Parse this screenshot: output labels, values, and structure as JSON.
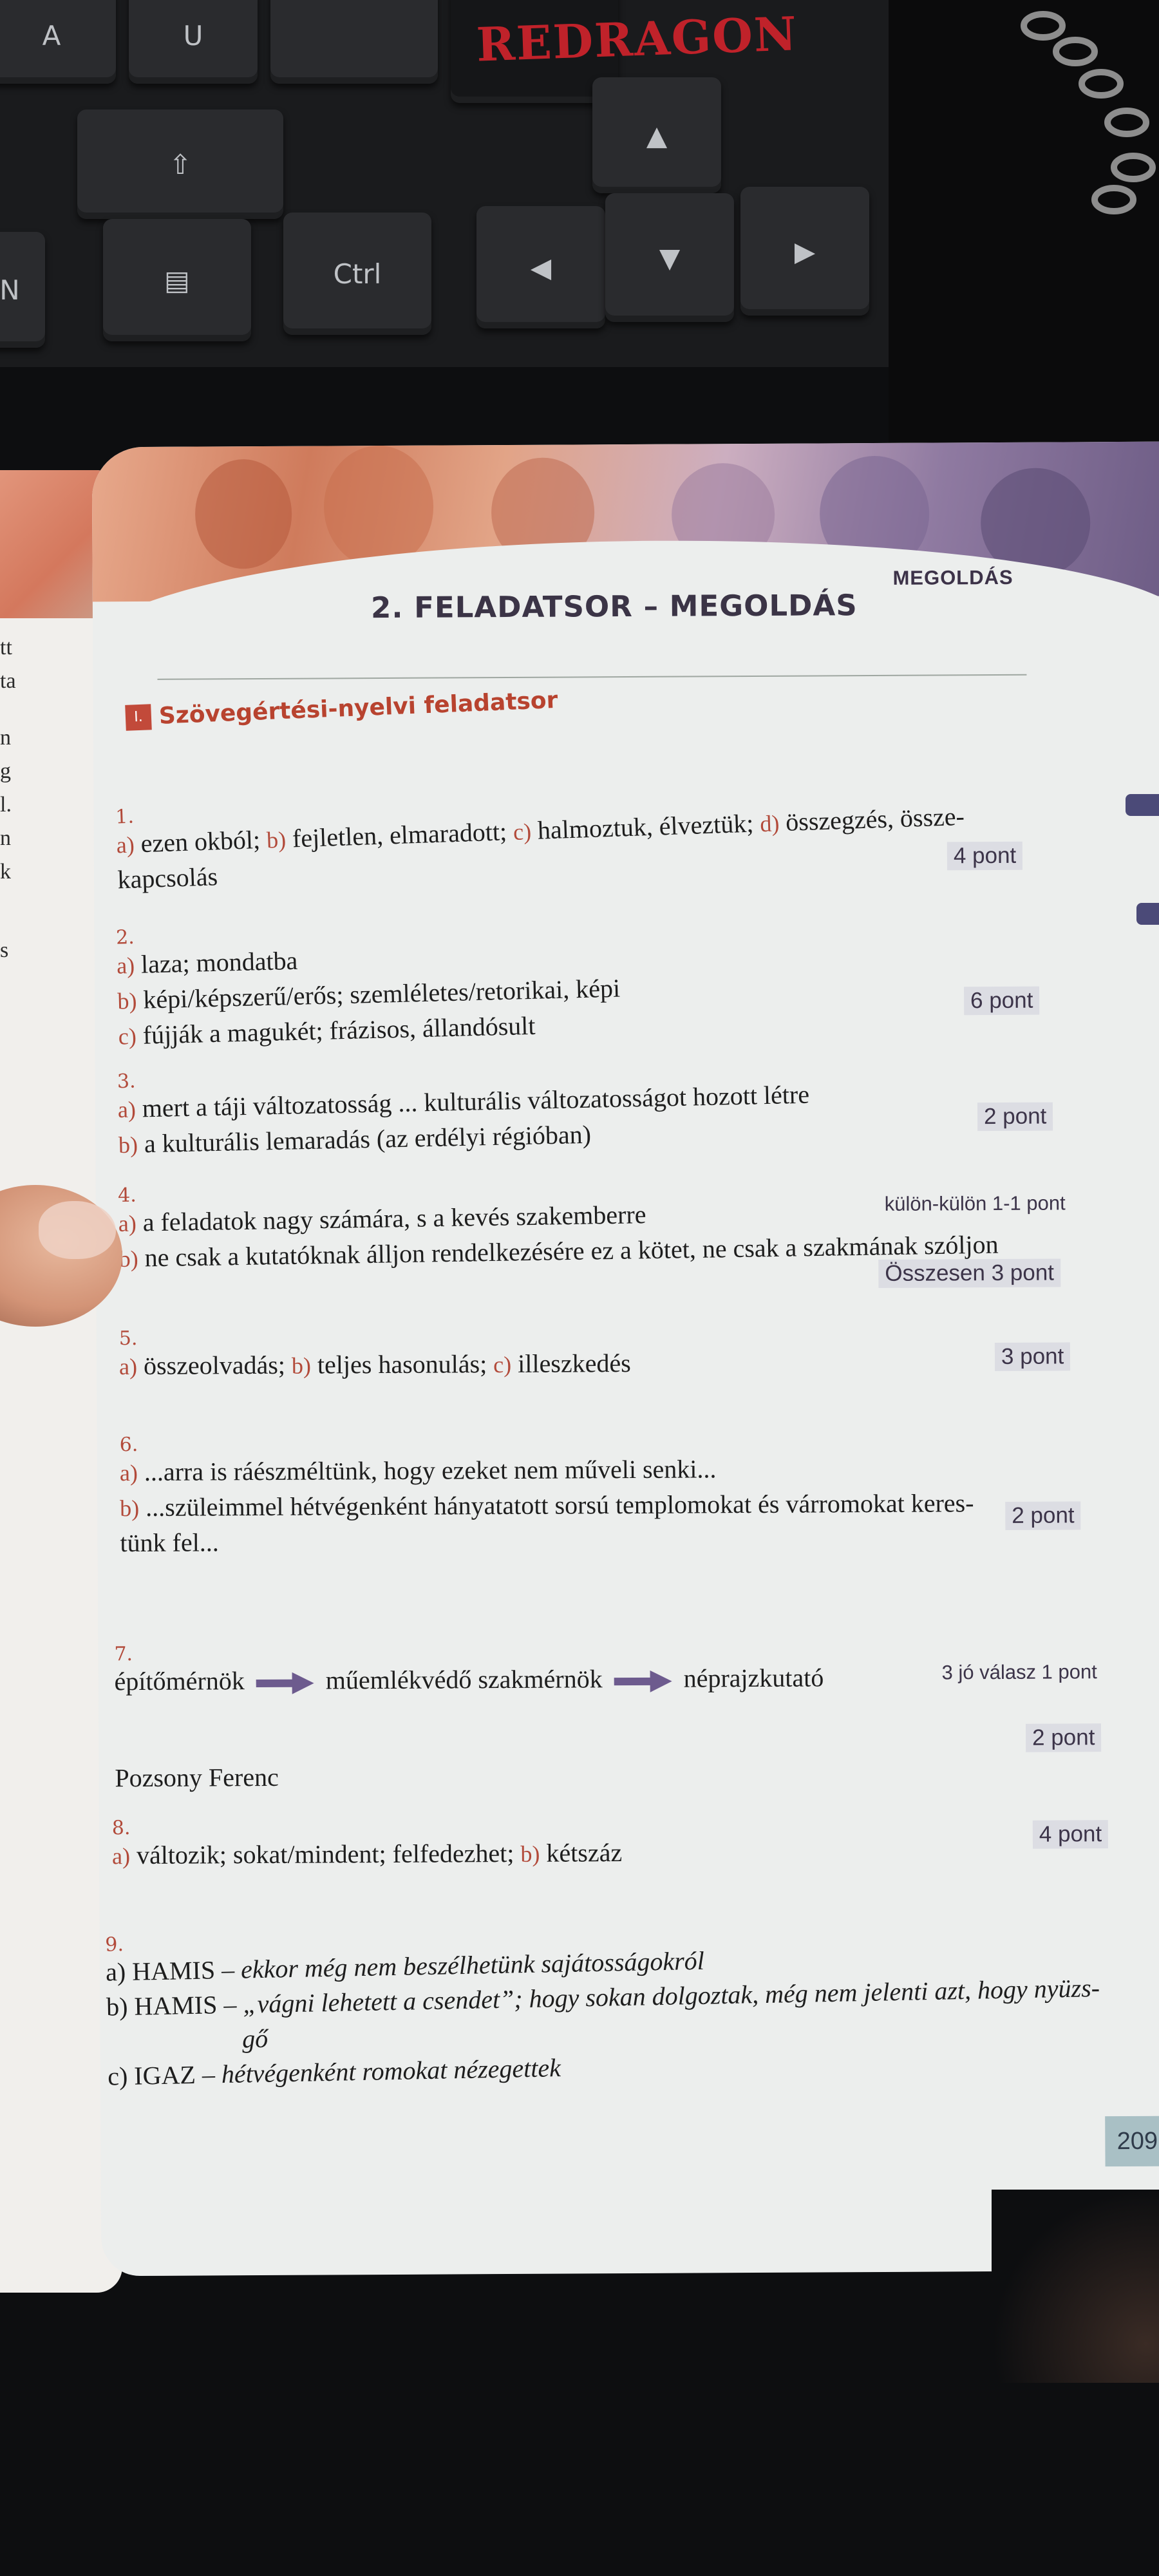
{
  "keyboard": {
    "brand": "REDRAGON",
    "keys": {
      "ctrl": "Ctrl",
      "n": "N",
      "a": "A",
      "u": "U"
    }
  },
  "left_page": {
    "letters": [
      "tt",
      "ta",
      "n",
      "g",
      "l.",
      "n",
      "k",
      "s"
    ]
  },
  "header": {
    "tag": "MEGOLDÁS",
    "title": "2. FELADATSOR – MEGOLDÁS"
  },
  "section": {
    "number": "I.",
    "title": "Szövegértési-nyelvi feladatsor"
  },
  "questions": {
    "q1": {
      "num": "1.",
      "a_label": "a)",
      "a": "ezen okból;",
      "b_label": "b)",
      "b": "fejletlen, elmaradott;",
      "c_label": "c)",
      "c": "halmoztuk, élveztük;",
      "d_label": "d)",
      "d": "összegzés, össze-",
      "cont": "kapcsolás",
      "points": "4 pont"
    },
    "q2": {
      "num": "2.",
      "a_label": "a)",
      "a": "laza; mondatba",
      "b_label": "b)",
      "b": "képi/képszerű/erős; szemléletes/retorikai, képi",
      "c_label": "c)",
      "c": "fújják a magukét; frázisos, állandósult",
      "points": "6 pont"
    },
    "q3": {
      "num": "3.",
      "a_label": "a)",
      "a": "mert a táji változatosság ... kulturális változatosságot hozott létre",
      "b_label": "b)",
      "b": "a kulturális lemaradás (az erdélyi régióban)",
      "points": "2 pont"
    },
    "q4": {
      "num": "4.",
      "a_label": "a)",
      "a": "a feladatok nagy számára, s a kevés szakemberre",
      "b_label": "b)",
      "b": "ne csak a kutatóknak álljon rendelkezésére ez a kötet, ne csak a szakmának szóljon",
      "points_each": "külön-külön 1-1 pont",
      "points_total": "Összesen 3 pont"
    },
    "q5": {
      "num": "5.",
      "a_label": "a)",
      "a": "összeolvadás;",
      "b_label": "b)",
      "b": "teljes hasonulás;",
      "c_label": "c)",
      "c": "illeszkedés",
      "points": "3 pont"
    },
    "q6": {
      "num": "6.",
      "a_label": "a)",
      "a": "...arra is ráészméltünk, hogy ezeket nem műveli senki...",
      "b_label": "b)",
      "b": "...szüleimmel hétvégenként hányatatott sorsú templomokat és várromokat keres-",
      "cont": "tünk fel...",
      "points": "2 pont"
    },
    "q7": {
      "num": "7.",
      "step1": "építőmérnök",
      "step2": "műemlékvédő szakmérnök",
      "step3": "néprajzkutató",
      "note": "3 jó válasz 1 pont",
      "name": "Pozsony Ferenc",
      "points": "2 pont"
    },
    "q8": {
      "num": "8.",
      "a_label": "a)",
      "a": "változik; sokat/mindent; felfedezhet;",
      "b_label": "b)",
      "b": "kétszáz",
      "points": "4 pont"
    },
    "q9": {
      "num": "9.",
      "a": "a) HAMIS – ",
      "a_italic": "ekkor még nem beszélhetünk sajátosságokról",
      "b": "b) HAMIS – ",
      "b_italic": "„vágni lehetett a csendet”; hogy sokan dolgoztak, még nem jelenti azt, hogy nyüzs-",
      "b_cont": "gő",
      "c": "c) IGAZ – ",
      "c_italic": "hétvégenként romokat nézegettek"
    }
  },
  "page_number": "209",
  "colors": {
    "accent_red": "#b24a3a",
    "header_purple": "#3c3248",
    "arrow_purple": "#6d5b8e",
    "points_bg": "#dcdde3"
  }
}
